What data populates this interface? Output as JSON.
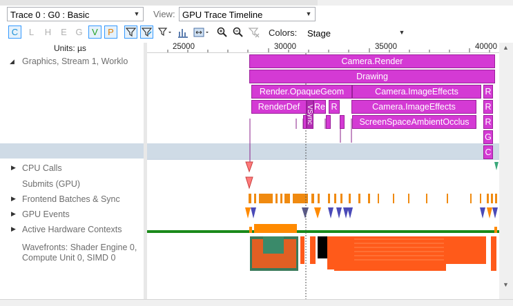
{
  "trace_select": {
    "value": "Trace 0 : G0 : Basic"
  },
  "view": {
    "label": "View:",
    "value": "GPU Trace Timeline"
  },
  "filter_buttons": [
    {
      "label": "C",
      "color": "#1a8fd6",
      "active": true
    },
    {
      "label": "L",
      "color": "#b0b0b0",
      "active": false
    },
    {
      "label": "H",
      "color": "#b0b0b0",
      "active": false
    },
    {
      "label": "E",
      "color": "#b0b0b0",
      "active": false
    },
    {
      "label": "G",
      "color": "#b0b0b0",
      "active": false
    },
    {
      "label": "V",
      "color": "#21a121",
      "active": true
    },
    {
      "label": "P",
      "color": "#e07b00",
      "active": true
    }
  ],
  "colors": {
    "label": "Colors:",
    "value": "Stage"
  },
  "ruler": {
    "units": "Units: µs",
    "ticks": [
      "25000",
      "30000",
      "35000",
      "40000"
    ]
  },
  "tracks": {
    "graphics": "Graphics, Stream 1, Worklo",
    "cpu_calls": "CPU Calls",
    "submits": "Submits (GPU)",
    "frontend": "Frontend Batches & Sync",
    "gpu_events": "GPU Events",
    "hw_contexts": "Active Hardware Contexts",
    "wavefronts": "Wavefronts: Shader Engine 0, Compute Unit 0, SIMD 0"
  },
  "blocks": {
    "camera_render": "Camera.Render",
    "drawing": "Drawing",
    "render_opaque": "Render.OpaqueGeom",
    "camera_fx1": "Camera.ImageEffects",
    "r1": "R",
    "renderdef": "RenderDef",
    "vsync": "VSync",
    "re": "Re",
    "r2": "R",
    "camera_fx2": "Camera.ImageEffects",
    "r3": "R",
    "ssao": "ScreenSpaceAmbientOcclus",
    "r4": "R",
    "g1": "G",
    "c1": "C"
  },
  "accent_colors": {
    "block": "#d43ad4",
    "orange": "#ff8a00",
    "green": "#1a8a1a",
    "blue": "#4a4ab8",
    "red": "#ff6b6b",
    "wave": "#ff5a1a"
  }
}
